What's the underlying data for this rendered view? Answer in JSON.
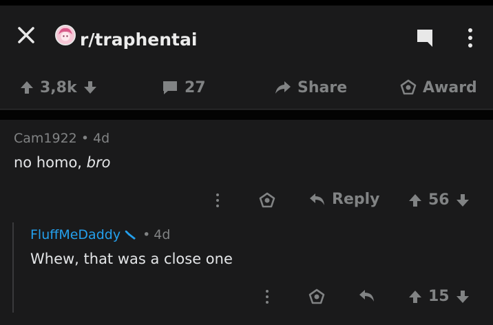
{
  "header": {
    "subreddit": "r/traphentai",
    "icons": {
      "close": "close-icon",
      "avatar": "subreddit-avatar",
      "bookmark": "bookmark-icon",
      "more": "more-vertical-icon"
    }
  },
  "post_actions": {
    "votes": "3,8k",
    "comments": "27",
    "share": "Share",
    "award": "Award"
  },
  "comments": [
    {
      "author": "Cam1922",
      "separator": "•",
      "age": "4d",
      "body_plain": "no homo, ",
      "body_italic": "bro",
      "reply_label": "Reply",
      "score": "56"
    },
    {
      "author": "FluffMeDaddy",
      "separator": "•",
      "age": "4d",
      "body": "Whew, that was a close one",
      "score": "15"
    }
  ],
  "colors": {
    "background": "#1a1a1b",
    "muted": "#818384",
    "text": "#e4e6e8",
    "link_blue": "#24a0ed"
  }
}
